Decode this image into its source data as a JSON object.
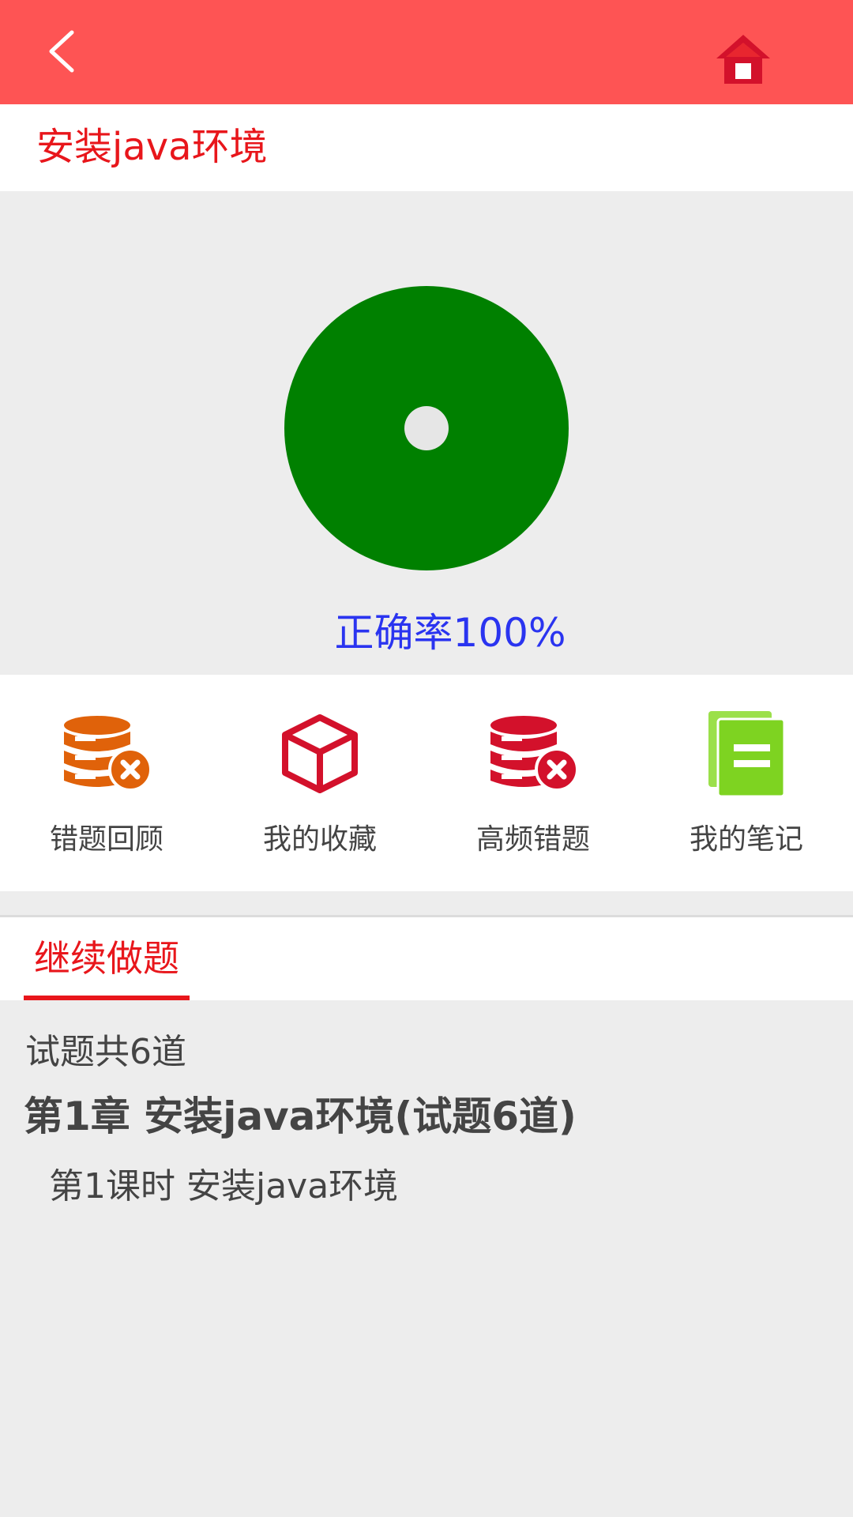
{
  "header": {
    "back_icon": "chevron-left-icon",
    "home_icon": "home-icon",
    "background_color": "#fe5454"
  },
  "page_title": "安装java环境",
  "stats": {
    "accuracy_label": "正确率100%",
    "accuracy_percent": 100,
    "correct_color": "#008000"
  },
  "tools": [
    {
      "label": "错题回顾",
      "icon": "database-error-icon",
      "color": "#e0620a"
    },
    {
      "label": "我的收藏",
      "icon": "cube-icon",
      "color": "#d3112b"
    },
    {
      "label": "高频错题",
      "icon": "database-error-icon",
      "color": "#d3112b"
    },
    {
      "label": "我的笔记",
      "icon": "notes-icon",
      "color": "#7ed321"
    }
  ],
  "tabs": [
    {
      "label": "继续做题",
      "active": true
    }
  ],
  "content": {
    "total": "试题共6道",
    "chapter": "第1章  安装java环境(试题6道)",
    "lesson": "第1课时  安装java环境"
  }
}
